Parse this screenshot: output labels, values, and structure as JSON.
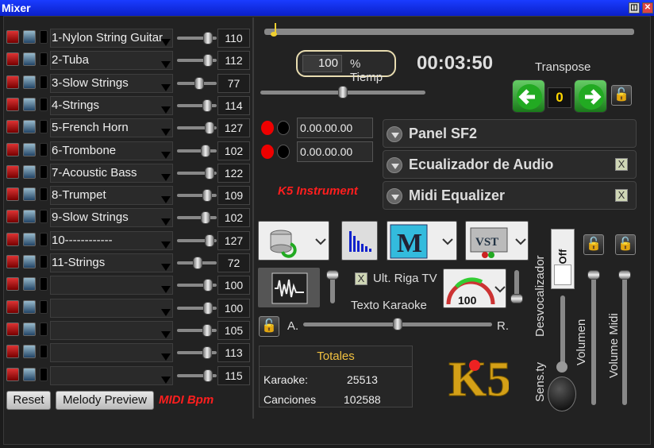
{
  "window": {
    "title": "Mixer",
    "btn_restore": "◫",
    "btn_close": "✕"
  },
  "channels": [
    {
      "name": "1-Nylon String Guitar",
      "value": "110",
      "level": 0.78
    },
    {
      "name": "2-Tuba",
      "value": "112",
      "level": 0.78
    },
    {
      "name": "3-Slow Strings",
      "value": "77",
      "level": 0.55
    },
    {
      "name": "4-Strings",
      "value": "114",
      "level": 0.76
    },
    {
      "name": "5-French Horn",
      "value": "127",
      "level": 0.82
    },
    {
      "name": "6-Trombone",
      "value": "102",
      "level": 0.71
    },
    {
      "name": "7-Acoustic Bass",
      "value": "122",
      "level": 0.82
    },
    {
      "name": "8-Trumpet",
      "value": "109",
      "level": 0.76
    },
    {
      "name": "9-Slow Strings",
      "value": "102",
      "level": 0.71
    },
    {
      "name": "10------------",
      "value": "127",
      "level": 0.82
    },
    {
      "name": "11-Strings",
      "value": "72",
      "level": 0.52
    },
    {
      "name": "",
      "value": "100",
      "level": 0.78
    },
    {
      "name": "",
      "value": "100",
      "level": 0.78
    },
    {
      "name": "",
      "value": "105",
      "level": 0.76
    },
    {
      "name": "",
      "value": "113",
      "level": 0.76
    },
    {
      "name": "",
      "value": "115",
      "level": 0.78
    }
  ],
  "buttons": {
    "reset": "Reset",
    "melody": "Melody Preview"
  },
  "midi_bpm": "MIDI Bpm",
  "playback": {
    "progress": 0.02,
    "tempo_value": "100",
    "tempo_label": "% Tiemp",
    "time": "00:03:50",
    "tempo_slider": 0.5
  },
  "transpose": {
    "label": "Transpose",
    "value": "0",
    "left_icon": "arrow-left-icon",
    "right_icon": "arrow-right-icon"
  },
  "markers": {
    "a": "0.00.00.00",
    "b": "0.00.00.00"
  },
  "k5_instrument": "K5 Instrument",
  "panels": [
    {
      "label": "Panel SF2",
      "checked": false
    },
    {
      "label": "Ecualizador de Audio",
      "checked": true
    },
    {
      "label": "Midi Equalizer",
      "checked": true
    }
  ],
  "ult_riga": {
    "label": "Ult. Riga TV",
    "checked": "X"
  },
  "texto_karaoke": "Texto Karaoke",
  "ab": {
    "a": "A.",
    "r": "R.",
    "level": 0.5
  },
  "gauge_value": "100",
  "totals": {
    "title": "Totales",
    "karaoke_label": "Karaoke:",
    "karaoke_value": "25513",
    "songs_label": "Canciones",
    "songs_value": "102588"
  },
  "logo": "K5",
  "right": {
    "off": "Off",
    "desvocalizador": "Desvocalizador",
    "sensty": "Sens.ty",
    "volumen": "Volumen",
    "volume_midi": "Volume Midi"
  },
  "colors": {
    "title_bar": "#0a1fc8",
    "accent_red": "#ff1e1e",
    "gauge_green": "#3c3",
    "transpose_value": "#ffd700",
    "totals_title": "#f0c040"
  }
}
